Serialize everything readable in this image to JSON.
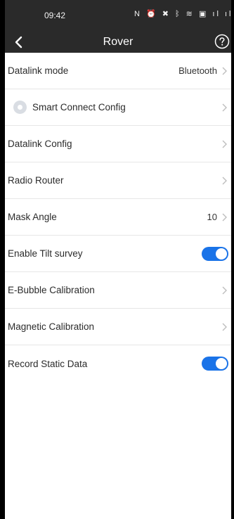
{
  "status_bar": {
    "time": "09:42",
    "icons": [
      "nfc-icon",
      "alarm-icon",
      "mute-icon",
      "bluetooth-icon",
      "wifi-icon",
      "hd-icon",
      "signal-icon",
      "signal-icon",
      "battery-icon"
    ],
    "icons_text": "N ⏰ ✖ ᛒ ≋ ▣ ıl ıl"
  },
  "nav": {
    "title": "Rover"
  },
  "rows": [
    {
      "label": "Datalink mode",
      "value": "Bluetooth",
      "kind": "chevron"
    },
    {
      "label": "Smart Connect Config",
      "kind": "chevron",
      "radio": true
    },
    {
      "label": "Datalink Config",
      "kind": "chevron"
    },
    {
      "label": "Radio Router",
      "kind": "chevron"
    },
    {
      "label": "Mask Angle",
      "value": "10",
      "kind": "chevron"
    },
    {
      "label": "Enable Tilt survey",
      "kind": "toggle",
      "on": true
    },
    {
      "label": "E-Bubble Calibration",
      "kind": "chevron"
    },
    {
      "label": "Magnetic Calibration",
      "kind": "chevron"
    },
    {
      "label": "Record Static Data",
      "kind": "toggle",
      "on": true
    }
  ],
  "colors": {
    "bar_bg": "#2a2a2a",
    "toggle_on": "#1a73e8",
    "divider": "#e6e6e6",
    "chevron": "#bdbdbd"
  }
}
